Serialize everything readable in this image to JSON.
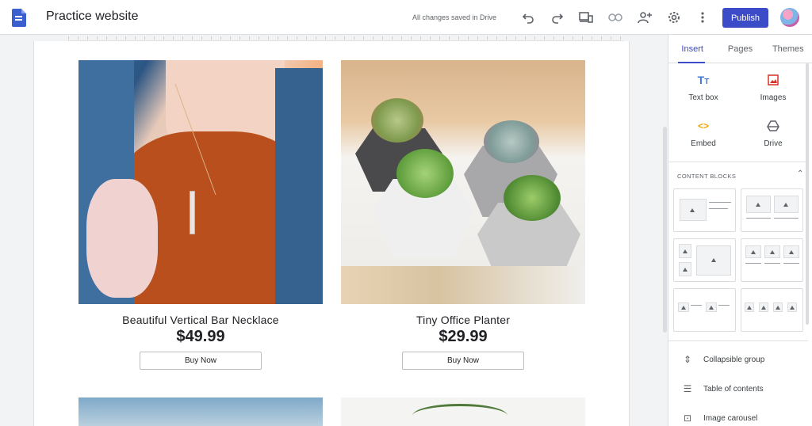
{
  "app": {
    "site_title": "Practice website",
    "save_status": "All changes saved in Drive",
    "publish_label": "Publish",
    "colors": {
      "accent": "#3c4bc7",
      "panel_bg": "#ffffff",
      "canvas_bg": "#f1f3f4"
    }
  },
  "toolbar": {
    "icons": [
      "undo-icon",
      "redo-icon",
      "preview-devices-icon",
      "link-icon",
      "share-add-person-icon",
      "settings-gear-icon",
      "more-vert-icon"
    ]
  },
  "products": [
    {
      "name": "Beautiful Vertical Bar Necklace",
      "price": "$49.99",
      "button": "Buy Now"
    },
    {
      "name": "Tiny Office Planter",
      "price": "$29.99",
      "button": "Buy Now"
    }
  ],
  "panel": {
    "tabs": [
      "Insert",
      "Pages",
      "Themes"
    ],
    "active_tab": "Insert",
    "insert_items": [
      {
        "label": "Text box",
        "icon": "text-box-icon"
      },
      {
        "label": "Images",
        "icon": "images-icon"
      },
      {
        "label": "Embed",
        "icon": "embed-code-icon"
      },
      {
        "label": "Drive",
        "icon": "drive-icon"
      }
    ],
    "content_blocks_header": "CONTENT BLOCKS",
    "list_items": [
      {
        "label": "Collapsible group",
        "icon": "collapsible-icon"
      },
      {
        "label": "Table of contents",
        "icon": "toc-icon"
      },
      {
        "label": "Image carousel",
        "icon": "carousel-icon"
      }
    ]
  }
}
